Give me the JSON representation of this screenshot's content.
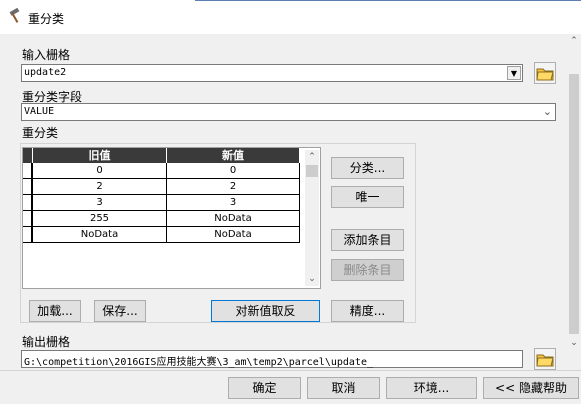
{
  "window": {
    "title": "重分类",
    "icon": "hammer-icon"
  },
  "input_raster": {
    "label": "输入栅格",
    "value": "update2"
  },
  "reclass_field": {
    "label": "重分类字段",
    "value": "VALUE"
  },
  "reclassification": {
    "label": "重分类",
    "columns": [
      "旧值",
      "新值"
    ],
    "rows": [
      {
        "old": "0",
        "new": "0"
      },
      {
        "old": "2",
        "new": "2"
      },
      {
        "old": "3",
        "new": "3"
      },
      {
        "old": "255",
        "new": "NoData"
      },
      {
        "old": "NoData",
        "new": "NoData"
      }
    ]
  },
  "side_buttons": {
    "classify": "分类...",
    "unique": "唯一",
    "add_entry": "添加条目",
    "delete_entry": "删除条目",
    "precision": "精度..."
  },
  "lower_buttons": {
    "load": "加载...",
    "save": "保存...",
    "reverse": "对新值取反"
  },
  "output_raster": {
    "label": "输出栅格",
    "value": "G:\\competition\\2016GIS应用技能大赛\\3_am\\temp2\\parcel\\update_"
  },
  "footer_buttons": {
    "ok": "确定",
    "cancel": "取消",
    "environments": "环境...",
    "hide_help": "<< 隐藏帮助"
  },
  "colors": {
    "accent": "#0078d7",
    "grid_header": "#3a3a3a",
    "folder": "#f5c542"
  }
}
